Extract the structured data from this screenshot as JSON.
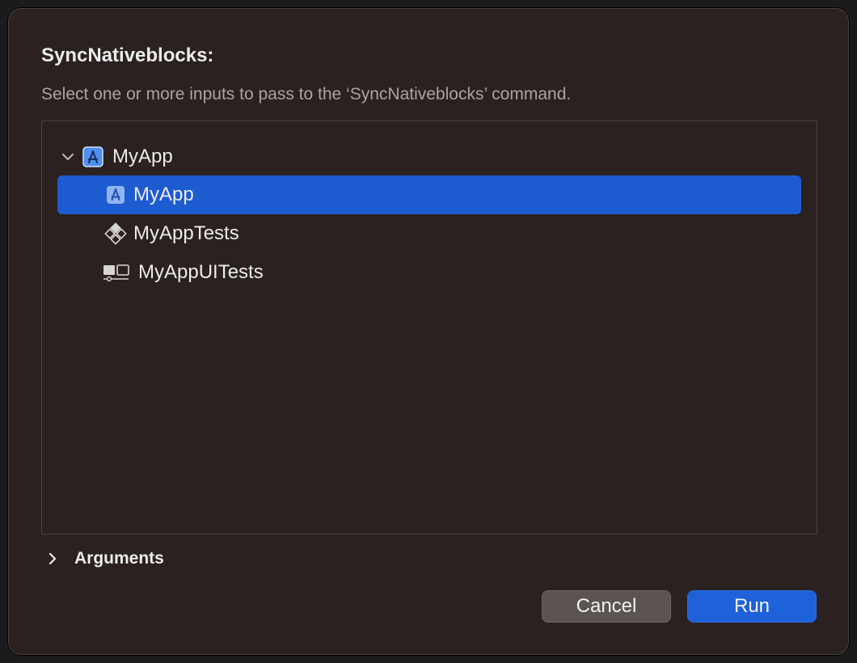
{
  "dialog": {
    "title": "SyncNativeblocks:",
    "subtitle": "Select one or more inputs to pass to the ‘SyncNativeblocks’ command."
  },
  "tree": {
    "group": {
      "label": "MyApp",
      "icon": "app-target-icon",
      "expanded": true
    },
    "items": [
      {
        "label": "MyApp",
        "icon": "app-target-icon",
        "selected": true
      },
      {
        "label": "MyAppTests",
        "icon": "unit-test-target-icon",
        "selected": false
      },
      {
        "label": "MyAppUITests",
        "icon": "ui-test-target-icon",
        "selected": false
      }
    ]
  },
  "arguments": {
    "label": "Arguments",
    "expanded": false
  },
  "buttons": {
    "cancel": "Cancel",
    "run": "Run"
  },
  "colors": {
    "accent": "#1d5bd1",
    "sheet_bg": "#2a2120",
    "cancel_bg": "#5b5453"
  }
}
